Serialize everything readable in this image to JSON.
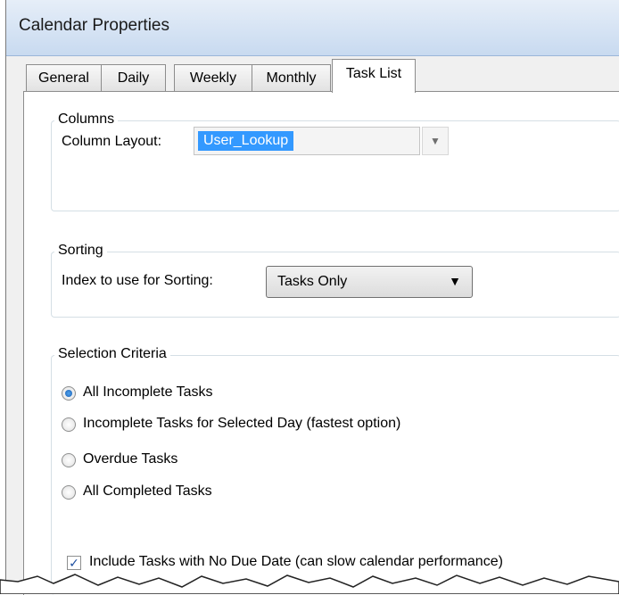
{
  "window": {
    "title": "Calendar Properties"
  },
  "tabs": [
    {
      "label": "General",
      "active": false
    },
    {
      "label": "Daily",
      "active": false
    },
    {
      "label": "Weekly",
      "active": false
    },
    {
      "label": "Monthly",
      "active": false
    },
    {
      "label": "Task List",
      "active": true
    }
  ],
  "columns_group": {
    "title": "Columns",
    "column_layout_label": "Column Layout:",
    "column_layout_value": "User_Lookup"
  },
  "sorting_group": {
    "title": "Sorting",
    "index_label": "Index to use for Sorting:",
    "index_value": "Tasks Only"
  },
  "selection_group": {
    "title": "Selection Criteria",
    "options": [
      {
        "label": "All Incomplete Tasks",
        "selected": true
      },
      {
        "label": "Incomplete Tasks for Selected Day (fastest option)",
        "selected": false
      },
      {
        "label": "Overdue Tasks",
        "selected": false
      },
      {
        "label": "All Completed Tasks",
        "selected": false
      }
    ],
    "include_no_due_date": {
      "label": "Include Tasks with No Due Date (can slow calendar performance)",
      "checked": true
    }
  }
}
